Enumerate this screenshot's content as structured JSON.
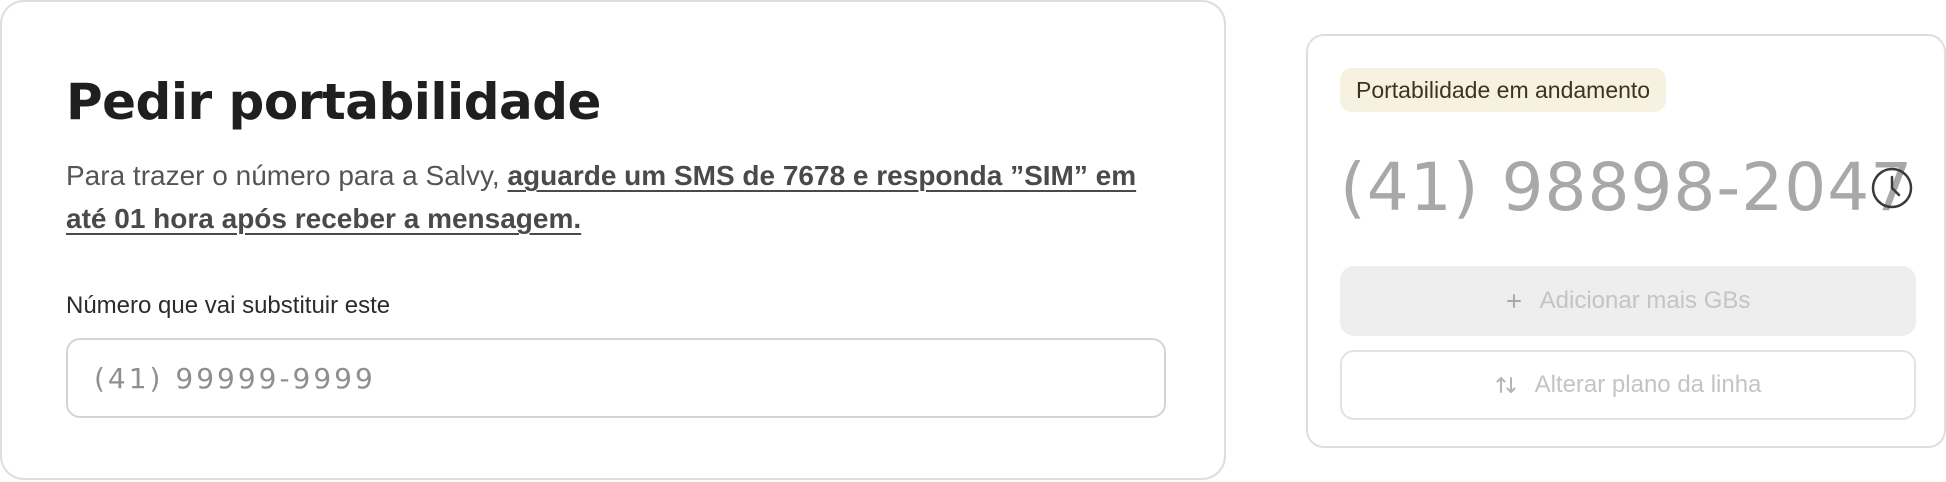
{
  "portability_card": {
    "title": "Pedir portabilidade",
    "description_prefix": "Para trazer o número para a Salvy, ",
    "description_emphasis": "aguarde um SMS de 7678 e  responda ”SIM” em até 01 hora após receber a mensagem.",
    "field_label": "Número que vai substituir este",
    "field_placeholder": "(41) 99999-9999",
    "field_value": ""
  },
  "line_card": {
    "status_badge": "Portabilidade em andamento",
    "phone_number": "(41) 98898-2047",
    "status_icon": "clock-icon",
    "add_gb_button": {
      "icon": "plus-icon",
      "label": "Adicionar mais GBs",
      "disabled": true
    },
    "change_plan_button": {
      "icon": "swap-arrows-icon",
      "label": "Alterar plano da linha",
      "disabled": true
    }
  },
  "colors": {
    "badge_bg": "#f6f1e1",
    "disabled_text": "#c4c4c4",
    "border": "#dedede"
  }
}
